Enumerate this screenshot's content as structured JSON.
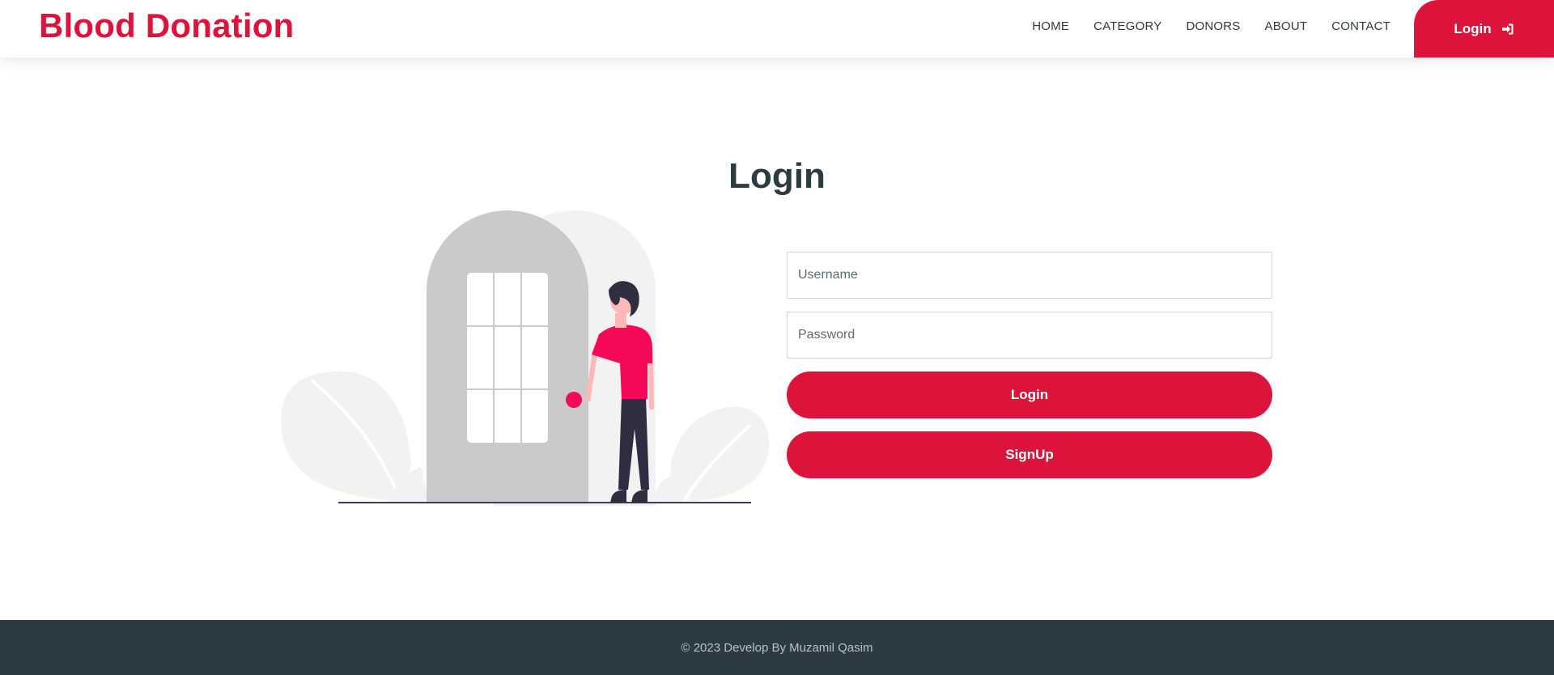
{
  "header": {
    "brand": "Blood Donation",
    "nav": [
      "HOME",
      "CATEGORY",
      "DONORS",
      "ABOUT",
      "CONTACT"
    ],
    "login_button": "Login",
    "login_icon": "sign-in-icon"
  },
  "main": {
    "title": "Login",
    "illustration": "person-at-door-illustration",
    "username_placeholder": "Username",
    "password_placeholder": "Password",
    "login_button": "Login",
    "signup_button": "SignUp"
  },
  "footer": {
    "copyright": "© 2023 Develop By Muzamil Qasim"
  },
  "colors": {
    "accent": "#dc143c",
    "dark": "#2c3a41",
    "footer_bg": "#2c3a41",
    "header_bg": "#ffffff"
  }
}
